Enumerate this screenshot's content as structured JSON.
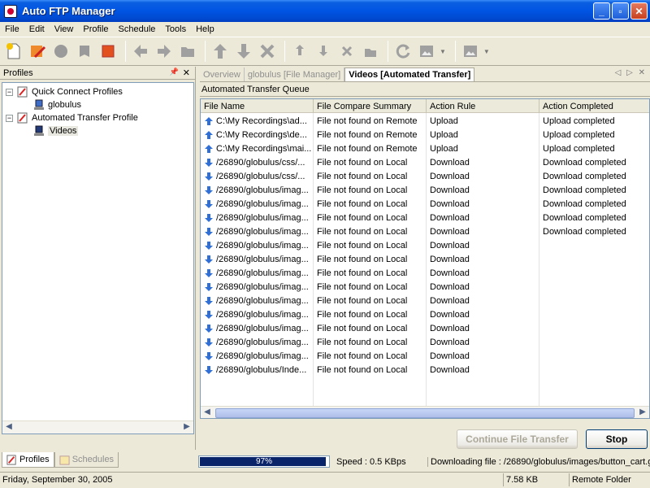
{
  "window": {
    "title": "Auto FTP Manager",
    "controls": [
      "_",
      "▫",
      "✕"
    ]
  },
  "menu": [
    "File",
    "Edit",
    "View",
    "Profile",
    "Schedule",
    "Tools",
    "Help"
  ],
  "left_panel": {
    "header": "Profiles",
    "pin_glyph": "📌",
    "close_glyph": "✕",
    "tree": [
      {
        "label": "Quick Connect Profiles",
        "expander": "−",
        "children": [
          {
            "label": "globulus"
          }
        ]
      },
      {
        "label": "Automated Transfer Profile",
        "expander": "−",
        "children": [
          {
            "label": "Videos"
          }
        ]
      }
    ],
    "tabs": [
      "Profiles",
      "Schedules"
    ]
  },
  "doc_tabs": [
    "Overview",
    "globulus [File Manager]",
    "Videos [Automated Transfer]"
  ],
  "doc_tab_nav": "◁ ▷ ✕",
  "queue": {
    "title": "Automated Transfer Queue",
    "columns": [
      "File Name",
      "File Compare Summary",
      "Action Rule",
      "Action Completed"
    ],
    "rows": [
      {
        "dir": "up",
        "name": "C:\\My Recordings\\ad...",
        "summary": "File not found on Remote",
        "rule": "Upload",
        "done": "Upload completed"
      },
      {
        "dir": "up",
        "name": "C:\\My Recordings\\de...",
        "summary": "File not found on Remote",
        "rule": "Upload",
        "done": "Upload completed"
      },
      {
        "dir": "up",
        "name": "C:\\My Recordings\\mai...",
        "summary": "File not found on Remote",
        "rule": "Upload",
        "done": "Upload completed"
      },
      {
        "dir": "down",
        "name": "/26890/globulus/css/...",
        "summary": "File not found on Local",
        "rule": "Download",
        "done": "Download completed"
      },
      {
        "dir": "down",
        "name": "/26890/globulus/css/...",
        "summary": "File not found on Local",
        "rule": "Download",
        "done": "Download completed"
      },
      {
        "dir": "down",
        "name": "/26890/globulus/imag...",
        "summary": "File not found on Local",
        "rule": "Download",
        "done": "Download completed"
      },
      {
        "dir": "down",
        "name": "/26890/globulus/imag...",
        "summary": "File not found on Local",
        "rule": "Download",
        "done": "Download completed"
      },
      {
        "dir": "down",
        "name": "/26890/globulus/imag...",
        "summary": "File not found on Local",
        "rule": "Download",
        "done": "Download completed"
      },
      {
        "dir": "down",
        "name": "/26890/globulus/imag...",
        "summary": "File not found on Local",
        "rule": "Download",
        "done": "Download completed"
      },
      {
        "dir": "down",
        "name": "/26890/globulus/imag...",
        "summary": "File not found on Local",
        "rule": "Download",
        "done": ""
      },
      {
        "dir": "down",
        "name": "/26890/globulus/imag...",
        "summary": "File not found on Local",
        "rule": "Download",
        "done": ""
      },
      {
        "dir": "down",
        "name": "/26890/globulus/imag...",
        "summary": "File not found on Local",
        "rule": "Download",
        "done": ""
      },
      {
        "dir": "down",
        "name": "/26890/globulus/imag...",
        "summary": "File not found on Local",
        "rule": "Download",
        "done": ""
      },
      {
        "dir": "down",
        "name": "/26890/globulus/imag...",
        "summary": "File not found on Local",
        "rule": "Download",
        "done": ""
      },
      {
        "dir": "down",
        "name": "/26890/globulus/imag...",
        "summary": "File not found on Local",
        "rule": "Download",
        "done": ""
      },
      {
        "dir": "down",
        "name": "/26890/globulus/imag...",
        "summary": "File not found on Local",
        "rule": "Download",
        "done": ""
      },
      {
        "dir": "down",
        "name": "/26890/globulus/imag...",
        "summary": "File not found on Local",
        "rule": "Download",
        "done": ""
      },
      {
        "dir": "down",
        "name": "/26890/globulus/imag...",
        "summary": "File not found on Local",
        "rule": "Download",
        "done": ""
      },
      {
        "dir": "down",
        "name": "/26890/globulus/Inde...",
        "summary": "File not found on Local",
        "rule": "Download",
        "done": ""
      }
    ]
  },
  "buttons": {
    "continue": "Continue File Transfer",
    "stop": "Stop"
  },
  "progress": {
    "fraction": 0.97,
    "label": "97%"
  },
  "speed_text": "Speed : 0.5 KBps",
  "downloading_text": "Downloading file : /26890/globulus/images/button_cart.g",
  "statusbar": {
    "date": "Friday, September 30, 2005",
    "size": "7.58 KB",
    "location": "Remote Folder"
  },
  "colors": {
    "titlebar": "#0054e3",
    "progress_fill": "#0a246a",
    "arrow_blue": "#2f6fd6"
  }
}
